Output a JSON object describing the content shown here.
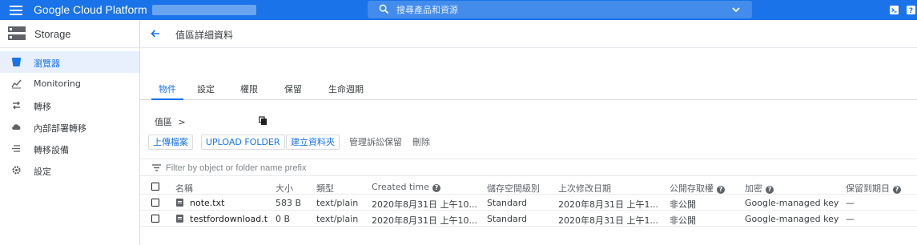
{
  "topbar": {
    "brand": "Google Cloud Platform",
    "search_placeholder": "搜尋產品和資源"
  },
  "sidebar": {
    "title": "Storage",
    "items": [
      {
        "label": "瀏覽器",
        "icon": "bucket-icon",
        "active": true
      },
      {
        "label": "Monitoring",
        "icon": "chart-icon"
      },
      {
        "label": "轉移",
        "icon": "transfer-icon"
      },
      {
        "label": "內部部署轉移",
        "icon": "cloud-upload-icon"
      },
      {
        "label": "轉移設備",
        "icon": "appliance-icon"
      },
      {
        "label": "設定",
        "icon": "gear-icon"
      }
    ]
  },
  "header": {
    "title": "值區詳細資料"
  },
  "tabs": [
    {
      "label": "物件",
      "active": true
    },
    {
      "label": "設定"
    },
    {
      "label": "權限"
    },
    {
      "label": "保留"
    },
    {
      "label": "生命週期"
    }
  ],
  "breadcrumb": {
    "root": "值區",
    "separator": ">"
  },
  "actions": {
    "upload_files": "上傳檔案",
    "upload_folder": "UPLOAD FOLDER",
    "create_folder": "建立資料夾",
    "manage_holds": "管理訴訟保留",
    "delete": "刪除"
  },
  "filter": {
    "placeholder": "Filter by object or folder name prefix"
  },
  "table": {
    "columns": [
      "名稱",
      "大小",
      "類型",
      "Created time",
      "儲存空間級別",
      "上次修改日期",
      "公開存取權",
      "加密",
      "保留到期日"
    ],
    "rows": [
      {
        "name": "note.txt",
        "size": "583 B",
        "type": "text/plain",
        "created": "2020年8月31日 上午10...",
        "storage_class": "Standard",
        "modified": "2020年8月31日 上午1...",
        "public": "非公開",
        "encryption": "Google-managed key",
        "retention": "—"
      },
      {
        "name": "testfordownload.t",
        "size": "0 B",
        "type": "text/plain",
        "created": "2020年8月31日 上午10...",
        "storage_class": "Standard",
        "modified": "2020年8月31日 上午1...",
        "public": "非公開",
        "encryption": "Google-managed key",
        "retention": "—"
      }
    ]
  },
  "colors": {
    "primary": "#1a73e8",
    "active_bg": "#e8f0fe"
  }
}
